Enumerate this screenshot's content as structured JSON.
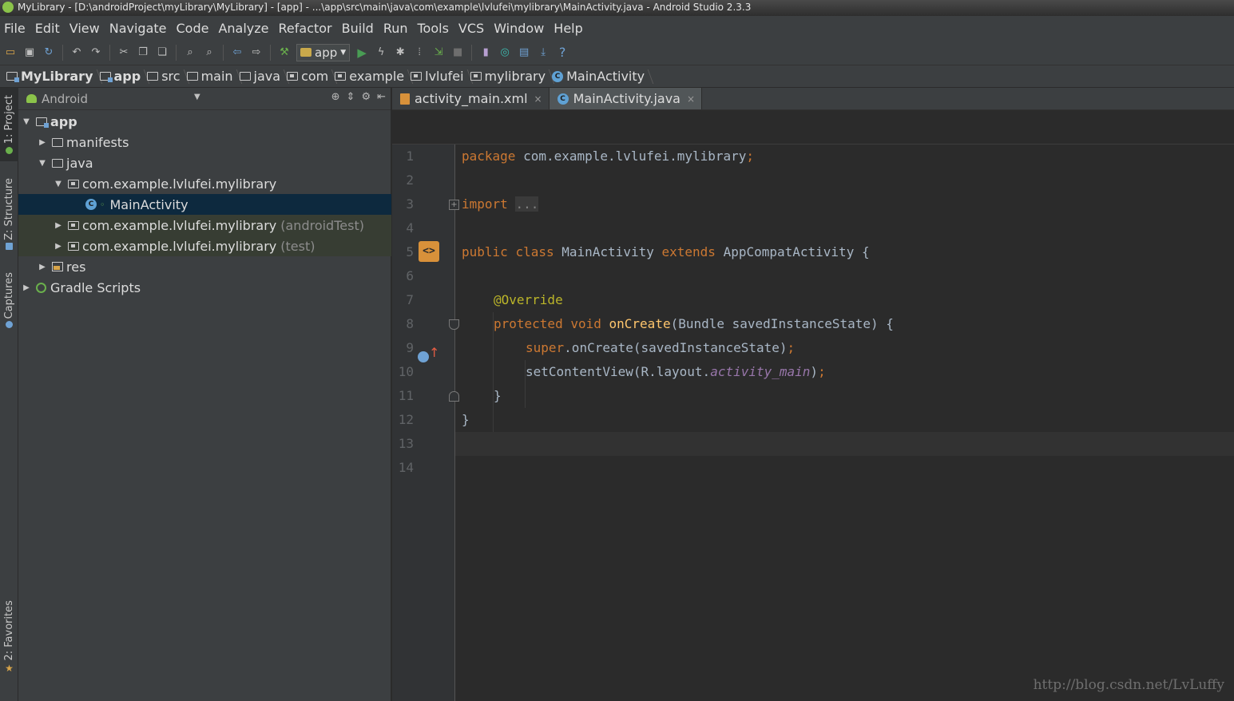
{
  "window": {
    "title": "MyLibrary - [D:\\androidProject\\myLibrary\\MyLibrary] - [app] - ...\\app\\src\\main\\java\\com\\example\\lvlufei\\mylibrary\\MainActivity.java - Android Studio 2.3.3"
  },
  "menu": [
    "File",
    "Edit",
    "View",
    "Navigate",
    "Code",
    "Analyze",
    "Refactor",
    "Build",
    "Run",
    "Tools",
    "VCS",
    "Window",
    "Help"
  ],
  "toolbar": {
    "run_config": "app",
    "icons": [
      "open-folder-icon",
      "save-icon",
      "sync-icon",
      "undo-icon",
      "redo-icon",
      "cut-icon",
      "copy-icon",
      "paste-icon",
      "find-icon",
      "replace-icon",
      "back-icon",
      "forward-icon",
      "make-project-icon",
      "run-icon",
      "apply-changes-icon",
      "debug-icon",
      "profile-icon",
      "attach-debugger-icon",
      "stop-icon",
      "avd-manager-icon",
      "gradle-sync-icon",
      "project-structure-icon",
      "sdk-manager-icon",
      "help-icon"
    ],
    "accent_run": "#499c54"
  },
  "breadcrumb": [
    "MyLibrary",
    "app",
    "src",
    "main",
    "java",
    "com",
    "example",
    "lvlufei",
    "mylibrary",
    "MainActivity"
  ],
  "left_tool_tabs": {
    "project": "1: Project",
    "structure": "Z: Structure",
    "captures": "Captures",
    "favorites": "2: Favorites"
  },
  "project_panel": {
    "view_mode": "Android",
    "tree": {
      "app": "app",
      "manifests": "manifests",
      "java": "java",
      "pkg_main": "com.example.lvlufei.mylibrary",
      "main_activity": "MainActivity",
      "pkg_android_test": "com.example.lvlufei.mylibrary",
      "pkg_android_test_suffix": "(androidTest)",
      "pkg_test": "com.example.lvlufei.mylibrary",
      "pkg_test_suffix": "(test)",
      "res": "res",
      "gradle_scripts": "Gradle Scripts"
    }
  },
  "editor": {
    "tabs": [
      {
        "label": "activity_main.xml",
        "active": false
      },
      {
        "label": "MainActivity.java",
        "active": true
      }
    ],
    "line_numbers": [
      "1",
      "2",
      "3",
      "4",
      "5",
      "6",
      "7",
      "8",
      "9",
      "10",
      "11",
      "12",
      "13",
      "14"
    ],
    "code": {
      "l1_kw": "package",
      "l1_rest": " com.example.lvlufei.mylibrary",
      "l1_semi": ";",
      "l3_kw": "import",
      "l3_fold": "...",
      "l6_kw1": "public",
      "l6_kw2": "class",
      "l6_name": "MainActivity",
      "l6_kw3": "extends",
      "l6_rest": "AppCompatActivity {",
      "l8_ann": "@Override",
      "l9_kw1": "protected",
      "l9_kw2": "void",
      "l9_fn": "onCreate",
      "l9_rest": "(Bundle savedInstanceState) {",
      "l10_kw": "super",
      "l10_rest": ".onCreate(savedInstanceState)",
      "l10_semi": ";",
      "l11_a": "setContentView(R.layout.",
      "l11_ital": "activity_main",
      "l11_b": ")",
      "l11_semi": ";",
      "l12": "}",
      "l13": "}"
    },
    "colors": {
      "keyword": "#cc7832",
      "annotation": "#bbb529",
      "method": "#ffc66d",
      "field": "#9876aa",
      "text": "#a9b7c6"
    }
  },
  "watermark": "http://blog.csdn.net/LvLuffy"
}
